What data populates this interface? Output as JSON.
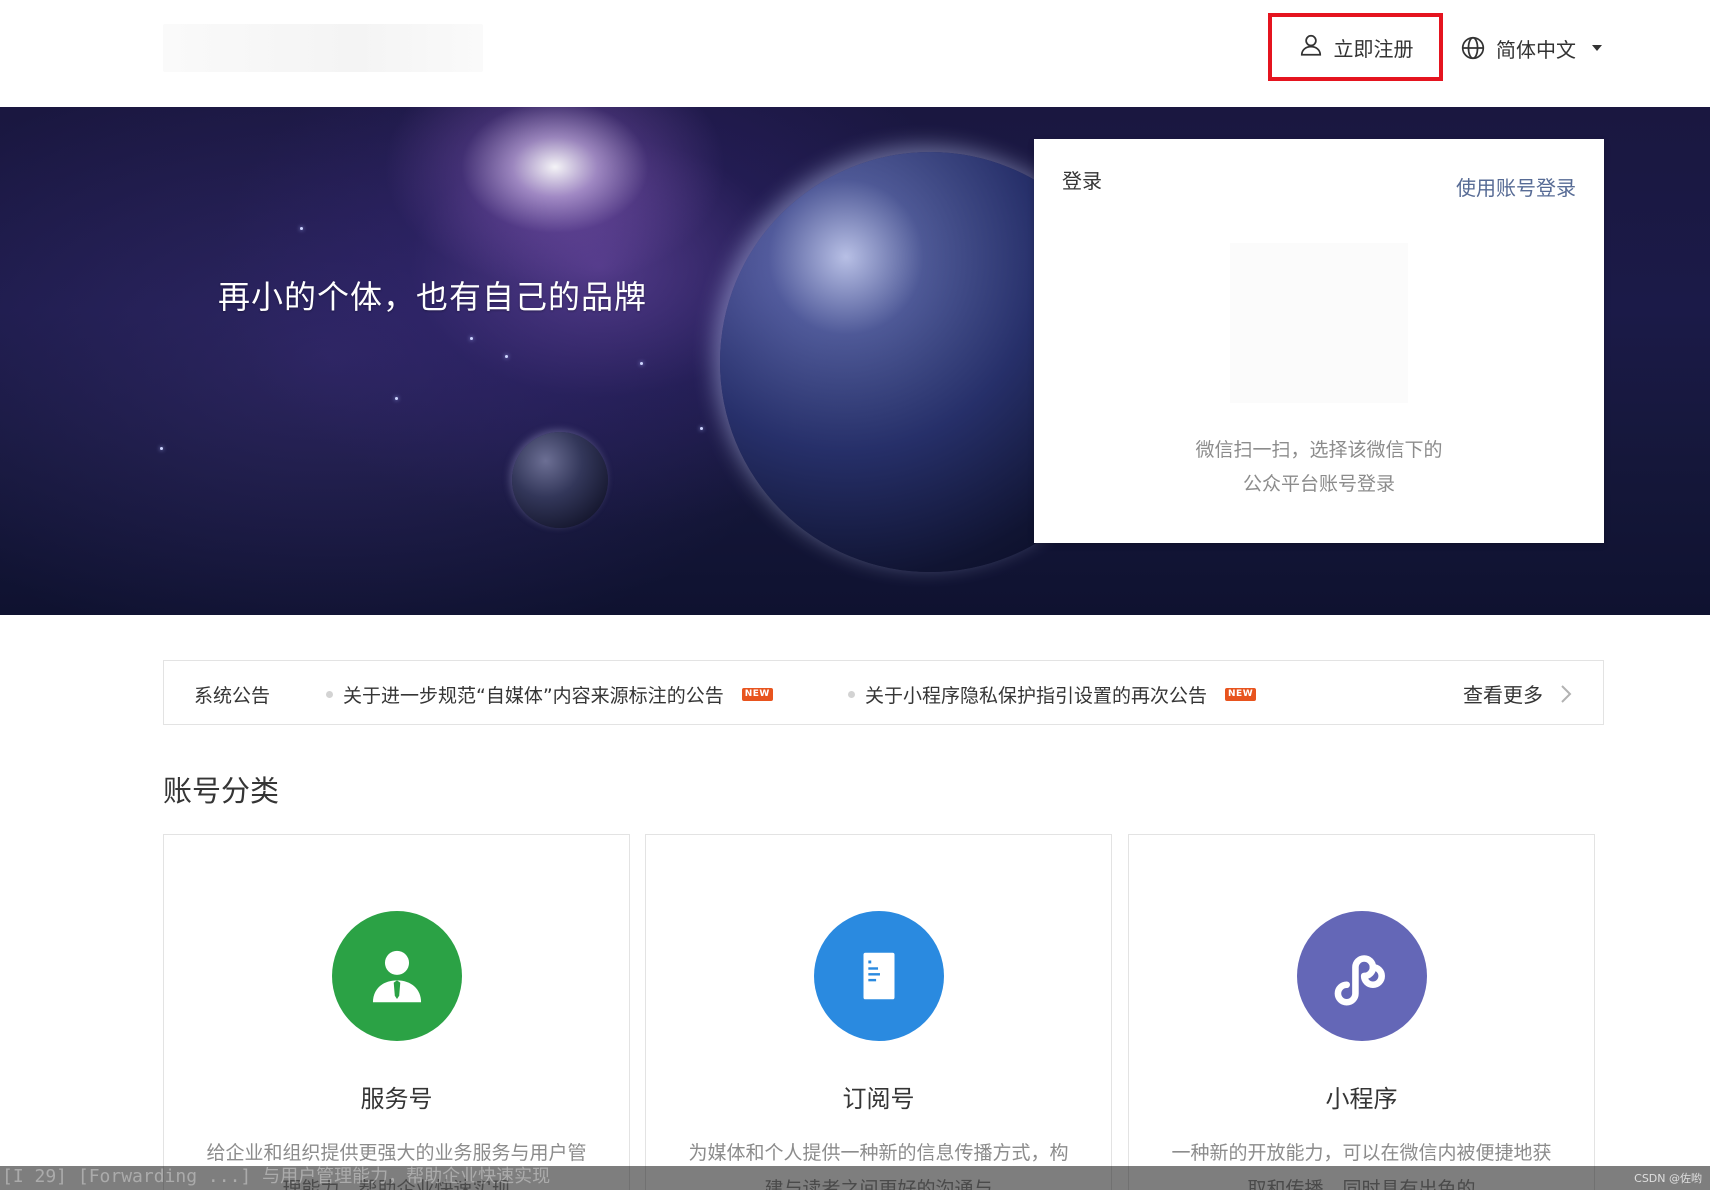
{
  "header": {
    "register_label": "立即注册",
    "language_label": "简体中文",
    "icons": {
      "register": "user-icon",
      "language": "globe-icon",
      "dropdown": "chevron-down-icon"
    }
  },
  "banner": {
    "slogan": "再小的个体，也有自己的品牌"
  },
  "login": {
    "title": "登录",
    "account_login_link": "使用账号登录",
    "qr_hint_line1": "微信扫一扫，选择该微信下的",
    "qr_hint_line2": "公众平台账号登录"
  },
  "notices": {
    "title": "系统公告",
    "items": [
      {
        "text": "关于进一步规范“自媒体”内容来源标注的公告",
        "badge": "NEW"
      },
      {
        "text": "关于小程序隐私保护指引设置的再次公告",
        "badge": "NEW"
      }
    ],
    "more_label": "查看更多"
  },
  "categories": {
    "title": "账号分类",
    "cards": [
      {
        "name": "服务号",
        "desc": "给企业和组织提供更强大的业务服务与用户管理能力，帮助企业快速实现",
        "icon": "user-tie-icon",
        "color": "#2ba245"
      },
      {
        "name": "订阅号",
        "desc": "为媒体和个人提供一种新的信息传播方式，构建与读者之间更好的沟通与",
        "icon": "document-icon",
        "color": "#2a8ae0"
      },
      {
        "name": "小程序",
        "desc": "一种新的开放能力，可以在微信内被便捷地获取和传播，同时具有出色的",
        "icon": "mini-program-icon",
        "color": "#6467b7"
      }
    ]
  },
  "colors": {
    "register_highlight": "#e5141f",
    "link_blue": "#576b95",
    "new_badge": "#e8541e"
  },
  "console": {
    "text": "[I 29] [Forwarding ...] 与用户管理能力，帮助企业快速实现",
    "watermark": "CSDN @佐哟"
  }
}
